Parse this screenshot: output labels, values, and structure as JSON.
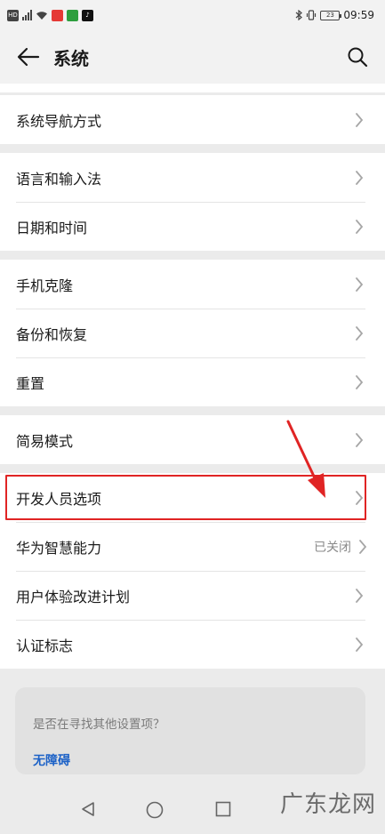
{
  "status_bar": {
    "left_chips": [
      "HD",
      "",
      "",
      ""
    ],
    "battery": "23",
    "time": "09:59"
  },
  "app_bar": {
    "title": "系统"
  },
  "groups": [
    [
      "系统导航方式"
    ],
    [
      "语言和输入法",
      "日期和时间"
    ],
    [
      "手机克隆",
      "备份和恢复",
      "重置"
    ],
    [
      "简易模式",
      "开发人员选项",
      "华为智慧能力",
      "用户体验改进计划",
      "认证标志"
    ]
  ],
  "items": {
    "navigation": "系统导航方式",
    "language": "语言和输入法",
    "datetime": "日期和时间",
    "clone": "手机克隆",
    "backup": "备份和恢复",
    "reset": "重置",
    "simple_mode": "简易模式",
    "developer": "开发人员选项",
    "huawei_ai": "华为智慧能力",
    "huawei_ai_value": "已关闭",
    "ux_plan": "用户体验改进计划",
    "certification": "认证标志"
  },
  "search_card": {
    "prompt": "是否在寻找其他设置项？",
    "link": "无障碍"
  },
  "watermark": "广东龙网",
  "colors": {
    "highlight": "#e02424",
    "link": "#1d62c7",
    "background": "#ebebeb"
  }
}
